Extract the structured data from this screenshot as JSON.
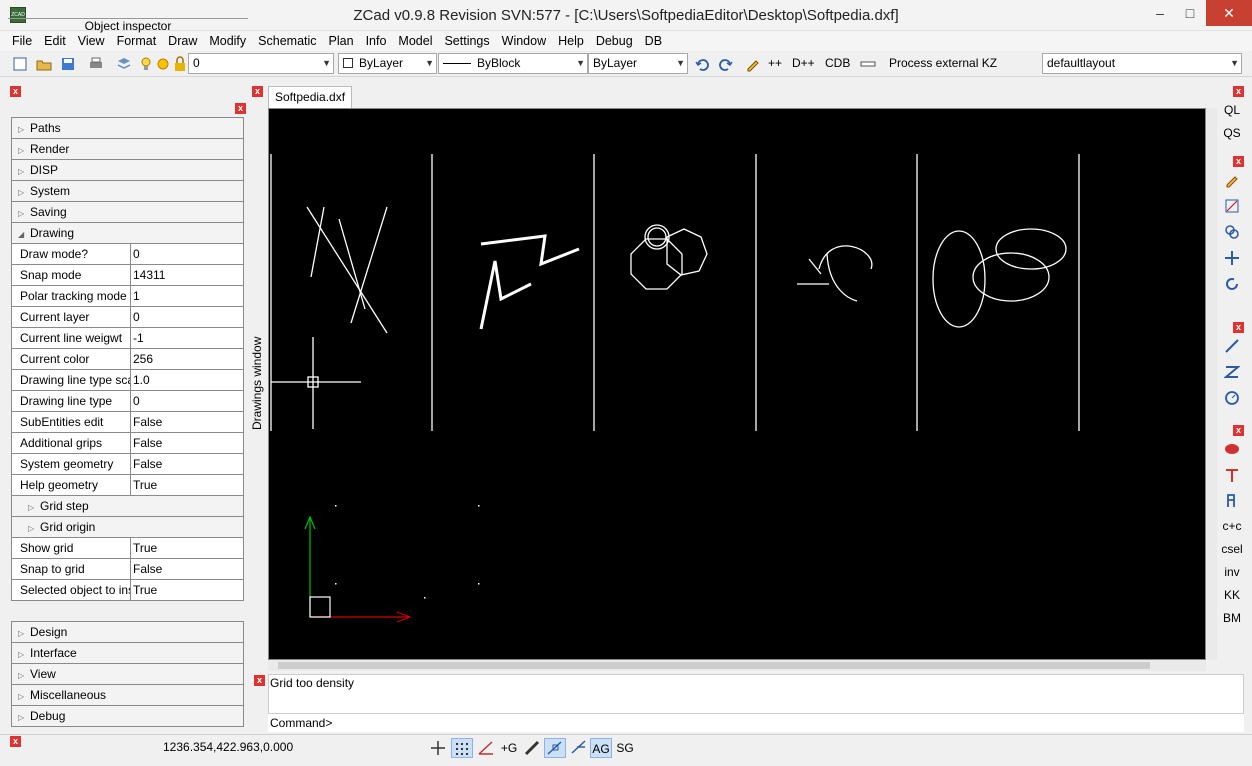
{
  "window": {
    "title": "ZCad v0.9.8 Revision SVN:577 - [C:\\Users\\SoftpediaEditor\\Desktop\\Softpedia.dxf]",
    "app_icon_text": "ZCAD",
    "minimize": "–",
    "maximize": "□",
    "close": "✕"
  },
  "menu": [
    "File",
    "Edit",
    "View",
    "Format",
    "Draw",
    "Modify",
    "Schematic",
    "Plan",
    "Info",
    "Model",
    "Settings",
    "Window",
    "Help",
    "Debug",
    "DB"
  ],
  "toolbar": {
    "layer_combo": "0",
    "color_combo": "ByLayer",
    "linetype_combo": "ByBlock",
    "lineweight_combo": "ByLayer",
    "btn_plusplus": "++",
    "btn_dplusplus": "D++",
    "btn_cdb": "CDB",
    "btn_process": "Process external KZ",
    "layout_combo": "defaultlayout"
  },
  "object_inspector": {
    "title": "Object inspector",
    "groups_top": [
      "Paths",
      "Render",
      "DISP",
      "System",
      "Saving"
    ],
    "drawing_group": "Drawing",
    "properties": [
      {
        "key": "Draw mode?",
        "value": "0"
      },
      {
        "key": "Snap mode",
        "value": "14311"
      },
      {
        "key": "Polar tracking mode",
        "value": "1"
      },
      {
        "key": "Current layer",
        "value": "0"
      },
      {
        "key": "Current line weigwt",
        "value": "-1"
      },
      {
        "key": "Current color",
        "value": "256"
      },
      {
        "key": "Drawing line type sca",
        "value": "1.0"
      },
      {
        "key": "Drawing line type",
        "value": "0"
      },
      {
        "key": "SubEntities edit",
        "value": "False"
      },
      {
        "key": "Additional grips",
        "value": "False"
      },
      {
        "key": "System geometry",
        "value": "False"
      },
      {
        "key": "Help geometry",
        "value": "True"
      }
    ],
    "subgroups": [
      "Grid step",
      "Grid origin"
    ],
    "properties2": [
      {
        "key": "Show grid",
        "value": "True"
      },
      {
        "key": "Snap to grid",
        "value": "False"
      },
      {
        "key": "Selected object to ins",
        "value": "True"
      }
    ],
    "groups_bottom": [
      "Design",
      "Interface",
      "View",
      "Miscellaneous",
      "Debug"
    ]
  },
  "side_strip_label": "Drawings window",
  "drawing_tab": "Softpedia.dxf",
  "command": {
    "log": "Grid too density",
    "prompt": "Command>"
  },
  "right_toolbar": [
    "QL",
    "QS",
    "c+c",
    "csel",
    "inv",
    "KK",
    "BM"
  ],
  "status": {
    "coords": "1236.354,422.963,0.000",
    "btn_g": "+G",
    "btn_ag": "AG",
    "btn_sg": "SG"
  },
  "colors": {
    "canvas": "#000000",
    "close_button": "#c84031",
    "axis_y": "#00c000",
    "axis_x": "#d00000"
  }
}
